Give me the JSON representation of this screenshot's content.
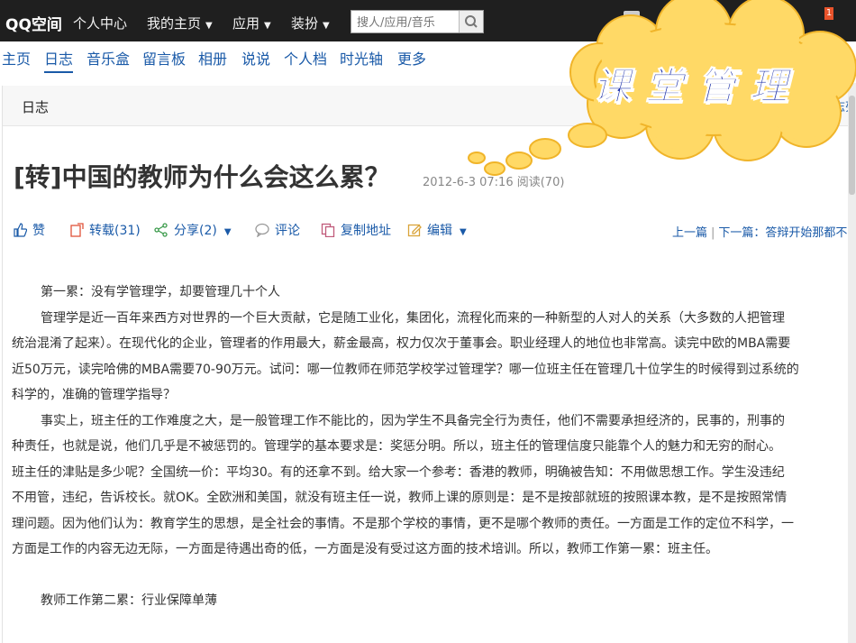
{
  "header": {
    "logo": "QQ空间",
    "nav": [
      "个人中心",
      "我的主页",
      "应用",
      "装扮"
    ],
    "search_placeholder": "搜人/应用/音乐",
    "notification_count": "1"
  },
  "subnav": [
    "主页",
    "日志",
    "音乐盒",
    "留言板",
    "相册",
    "说说",
    "个人档",
    "时光轴",
    "更多"
  ],
  "section": {
    "title": "日志",
    "right_link": "回日志列"
  },
  "post": {
    "title": "[转]中国的教师为什么会这么累？",
    "meta": "2012-6-3 07:16  阅读(70)"
  },
  "actions": {
    "like": "赞",
    "repost": "转载(31)",
    "share": "分享(2)",
    "comment": "评论",
    "copy": "复制地址",
    "edit": "编辑"
  },
  "nav_links": {
    "prev": "上一篇",
    "next": "下一篇：答辩开始那都不公平"
  },
  "overlay": {
    "text": "课堂管理"
  },
  "article": {
    "lines": [
      "第一累：没有学管理学，却要管理几十个人",
      "管理学是近一百年来西方对世界的一个巨大贡献，它是随工业化，集团化，流程化而来的一种新型的人对人的关系（大多数的人把管理",
      "统治混淆了起来）。在现代化的企业，管理者的作用最大，薪金最高，权力仅次于董事会。职业经理人的地位也非常高。读完中欧的MBA需要",
      "近50万元，读完哈佛的MBA需要70-90万元。试问：哪一位教师在师范学校学过管理学？哪一位班主任在管理几十位学生的时候得到过系统的",
      "科学的，准确的管理学指导？",
      "事实上，班主任的工作难度之大，是一般管理工作不能比的，因为学生不具备完全行为责任，他们不需要承担经济的，民事的，刑事的",
      "种责任，也就是说，他们几乎是不被惩罚的。管理学的基本要求是：奖惩分明。所以，班主任的管理信度只能靠个人的魅力和无穷的耐心。",
      "班主任的津贴是多少呢？全国统一价：平均30。有的还拿不到。给大家一个参考：香港的教师，明确被告知：不用做思想工作。学生没违纪",
      "不用管，违纪，告诉校长。就OK。全欧洲和美国，就没有班主任一说，教师上课的原则是：是不是按部就班的按照课本教，是不是按照常情",
      "理问题。因为他们认为：教育学生的思想，是全社会的事情。不是那个学校的事情，更不是哪个教师的责任。一方面是工作的定位不科学，一",
      "方面是工作的内容无边无际，一方面是待遇出奇的低，一方面是没有受过这方面的技术培训。所以，教师工作第一累：班主任。",
      "",
      "教师工作第二累：行业保障单薄"
    ]
  },
  "colors": {
    "topbar": "#1f1f1f",
    "link": "#1a5aa8",
    "cloud": "#ffd966",
    "overlay_text": "#1b2fa8"
  }
}
